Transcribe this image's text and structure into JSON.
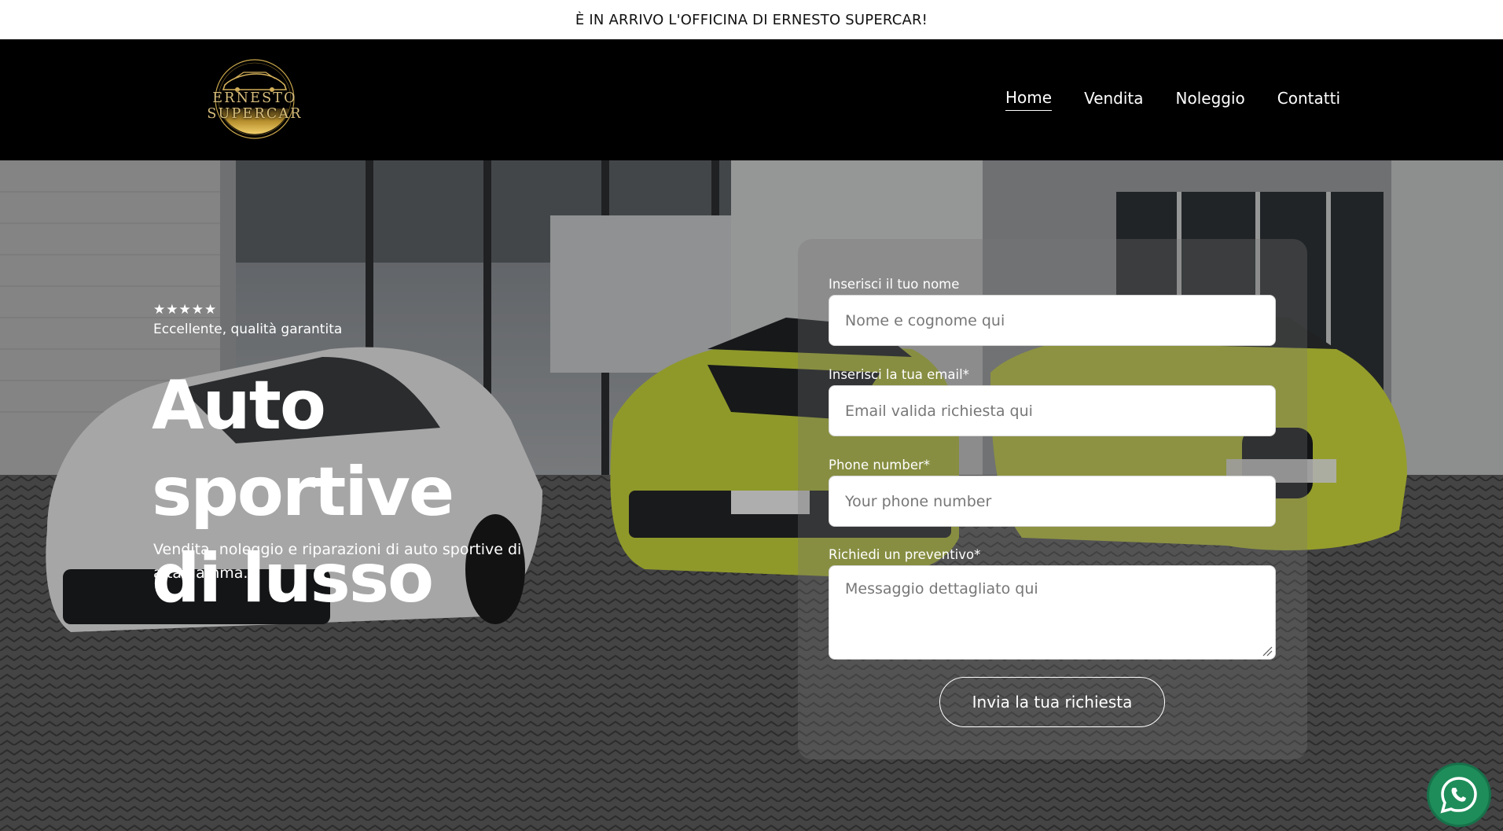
{
  "announcement": {
    "text": "È IN ARRIVO L'OFFICINA DI ERNESTO SUPERCAR!"
  },
  "header": {
    "logo_text": "ERNESTO SUPERCAR",
    "nav": [
      {
        "label": "Home",
        "active": true
      },
      {
        "label": "Vendita",
        "active": false
      },
      {
        "label": "Noleggio",
        "active": false
      },
      {
        "label": "Contatti",
        "active": false
      }
    ]
  },
  "hero": {
    "stars": "★★★★★",
    "rating_text": "Eccellente, qualità garantita",
    "headline_line1": "Auto sportive",
    "headline_line2": "di lusso",
    "subtext": "Vendita, noleggio e riparazioni di auto sportive di alta gamma."
  },
  "form": {
    "name_label": "Inserisci il tuo nome",
    "name_placeholder": "Nome e cognome qui",
    "email_label": "Inserisci la tua email*",
    "email_placeholder": "Email valida richiesta qui",
    "phone_label": "Phone number*",
    "phone_placeholder": "Your phone number",
    "message_label": "Richiedi un preventivo*",
    "message_placeholder": "Messaggio dettagliato qui",
    "submit_label": "Invia la tua richiesta"
  },
  "colors": {
    "header_bg": "#000000",
    "logo_gold": "#c9a64a",
    "whatsapp_green": "#1e8d5a",
    "car_yellow": "#c9d63a"
  },
  "icons": {
    "whatsapp": "whatsapp-icon"
  }
}
